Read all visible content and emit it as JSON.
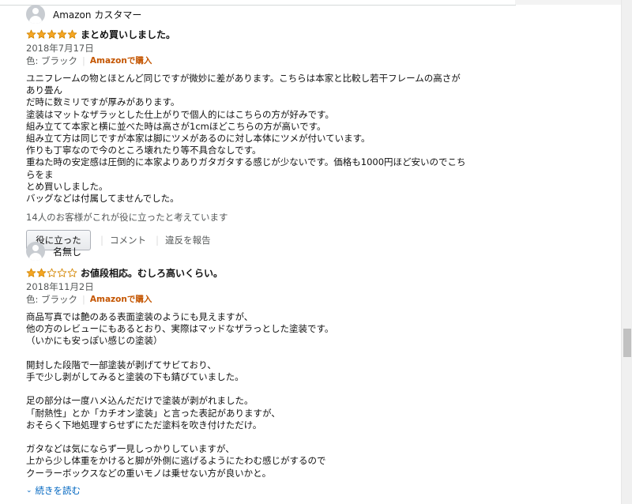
{
  "reviews": [
    {
      "author": "Amazon カスタマー",
      "rating": 5,
      "title": "まとめ買いしました。",
      "date": "2018年7月17日",
      "color_label": "色: ブラック",
      "verified": "Amazonで購入",
      "body": "ユニフレームの物とほとんど同じですが微妙に差があります。こちらは本家と比較し若干フレームの高さがあり畳ん\nだ時に数ミリですが厚みがあります。\n塗装はマットなザラッとした仕上がりで個人的にはこちらの方が好みです。\n組み立てて本家と横に並べた時は高さが1cmほどこちらの方が高いです。\n組み立て方は同じですが本家は脚にツメがあるのに対し本体にツメが付いています。\n作りも丁寧なので今のところ壊れたり等不具合なしです。\n重ねた時の安定感は圧倒的に本家よりありガタガタする感じが少ないです。価格も1000円ほど安いのでこちらをま\nとめ買いしました。\nバッグなどは付属してませんでした。",
      "helpful_text": "14人のお客様がこれが役に立ったと考えています",
      "helpful_button": "役に立った",
      "comment_link": "コメント",
      "report_link": "違反を報告"
    },
    {
      "author": "名無し",
      "rating": 2,
      "title": "お値段相応。むしろ高いくらい。",
      "date": "2018年11月2日",
      "color_label": "色: ブラック",
      "verified": "Amazonで購入",
      "body": "商品写真では艶のある表面塗装のようにも見えますが、\n他の方のレビューにもあるとおり、実際はマッドなザラっとした塗装です。\n（いかにも安っぽい感じの塗装）\n\n開封した段階で一部塗装が剥げてサビており、\n手で少し剥がしてみると塗装の下も錆びていました。\n\n足の部分は一度ハメ込んだだけで塗装が剥がれました。\n「耐熱性」とか「カチオン塗装」と言った表記がありますが、\nおそらく下地処理すらせずにただ塗料を吹き付けただけ。\n\nガタなどは気にならず一見しっかりしていますが、\n上から少し体重をかけると脚が外側に逃げるようにたわむ感じがするので\nクーラーボックスなどの重いモノは乗せない方が良いかと。",
      "read_more": "続きを読む"
    }
  ],
  "colors": {
    "star_fill": "#f5a623",
    "star_stroke": "#d48806",
    "verified": "#c45500",
    "link": "#0066c0"
  }
}
